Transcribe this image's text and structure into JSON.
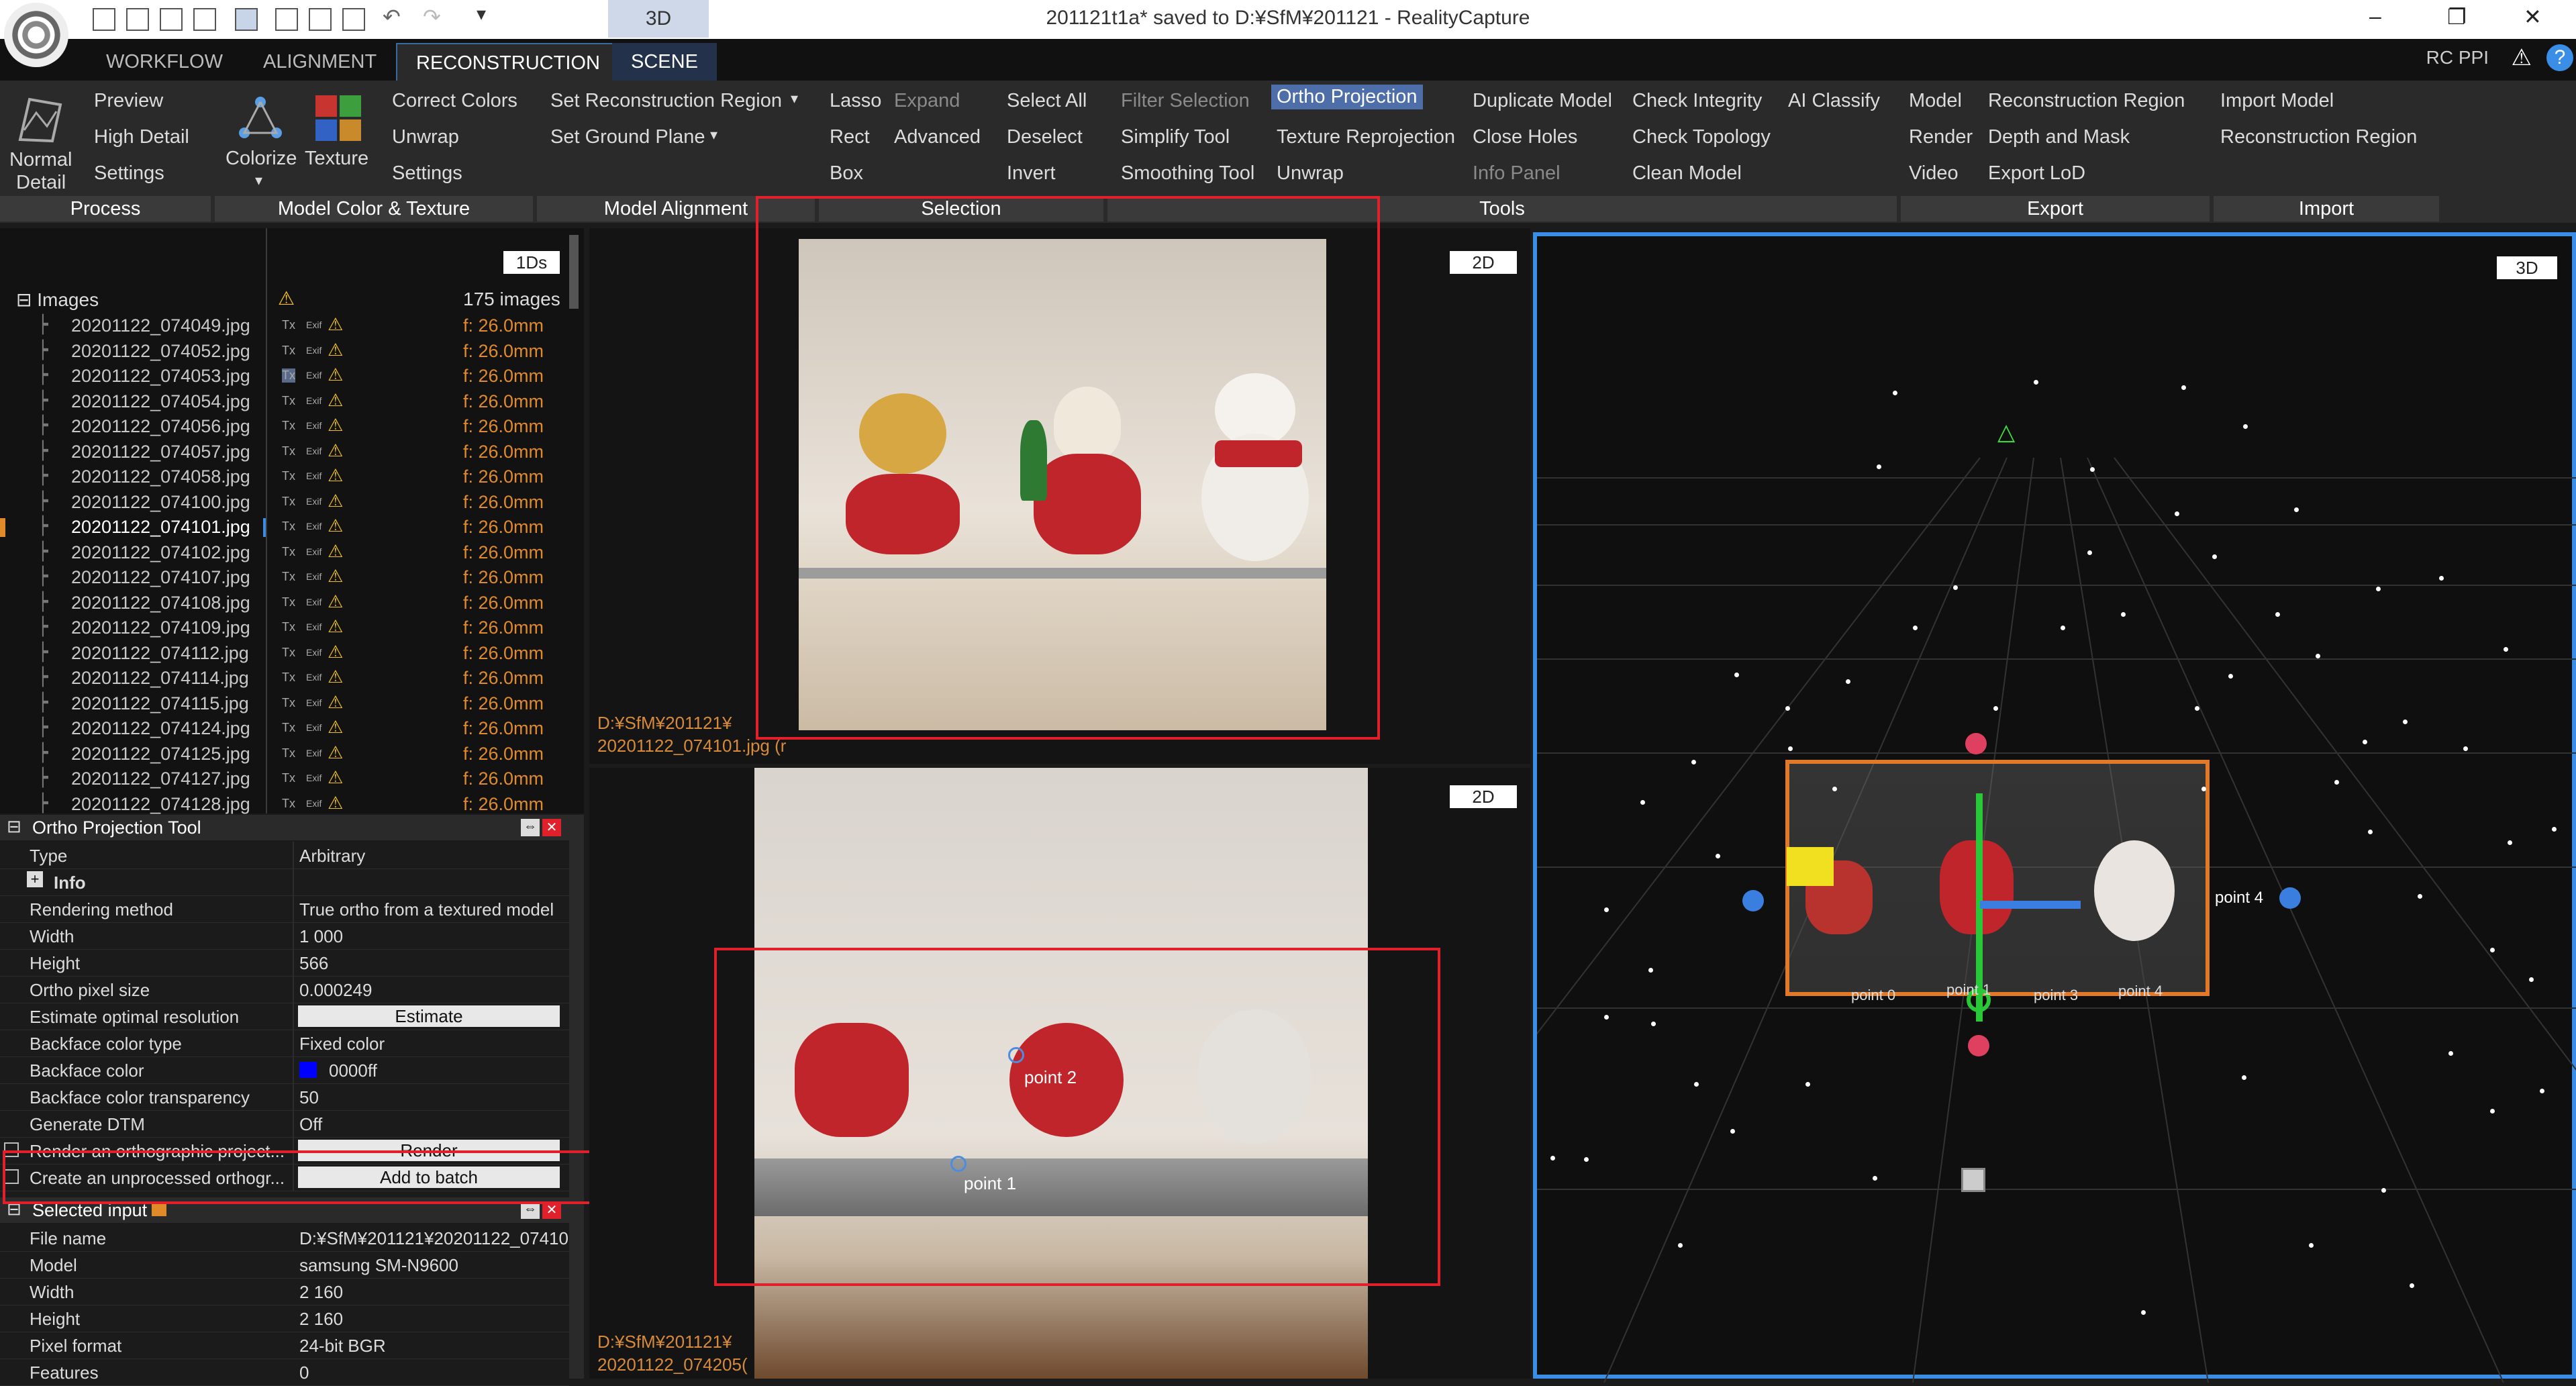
{
  "window": {
    "title": "201121t1a* saved to D:¥SfM¥201121 - RealityCapture",
    "view_tab": "3D",
    "min": "–",
    "restore": "❐",
    "close": "✕"
  },
  "menu_tabs": [
    "WORKFLOW",
    "ALIGNMENT",
    "RECONSTRUCTION",
    "SCENE"
  ],
  "rc_ppi": "RC PPI",
  "ribbon": {
    "process": {
      "normal": "Normal",
      "detail": "Detail",
      "preview": "Preview",
      "high_detail": "High Detail",
      "settings": "Settings"
    },
    "model_color": {
      "colorize": "Colorize",
      "texture": "Texture",
      "correct_colors": "Correct Colors",
      "unwrap": "Unwrap",
      "settings": "Settings"
    },
    "alignment": {
      "set_recon_region": "Set Reconstruction Region",
      "set_ground_plane": "Set Ground Plane"
    },
    "selection": {
      "lasso": "Lasso",
      "expand": "Expand",
      "select_all": "Select All",
      "rect": "Rect",
      "advanced": "Advanced",
      "deselect": "Deselect",
      "box": "Box",
      "invert": "Invert"
    },
    "tools": {
      "filter_selection": "Filter Selection",
      "ortho_projection": "Ortho Projection",
      "duplicate_model": "Duplicate Model",
      "check_integrity": "Check Integrity",
      "ai_classify": "AI Classify",
      "simplify_tool": "Simplify Tool",
      "texture_reprojection": "Texture Reprojection",
      "close_holes": "Close Holes",
      "check_topology": "Check Topology",
      "smoothing_tool": "Smoothing Tool",
      "unwrap": "Unwrap",
      "info_panel": "Info Panel",
      "clean_model": "Clean Model"
    },
    "export": {
      "model": "Model",
      "reconstruction_region": "Reconstruction Region",
      "render": "Render",
      "depth_and_mask": "Depth and Mask",
      "video": "Video",
      "export_lod": "Export LoD"
    },
    "import": {
      "import_model": "Import Model",
      "reconstruction_region": "Reconstruction Region"
    },
    "groups": [
      "Process",
      "Model Color & Texture",
      "Model Alignment",
      "Selection",
      "Tools",
      "Export",
      "Import"
    ]
  },
  "images_panel": {
    "badge": "1Ds",
    "root": "Images",
    "count": "175 images",
    "files": [
      "20201122_074049.jpg",
      "20201122_074052.jpg",
      "20201122_074053.jpg",
      "20201122_074054.jpg",
      "20201122_074056.jpg",
      "20201122_074057.jpg",
      "20201122_074058.jpg",
      "20201122_074100.jpg",
      "20201122_074101.jpg",
      "20201122_074102.jpg",
      "20201122_074107.jpg",
      "20201122_074108.jpg",
      "20201122_074109.jpg",
      "20201122_074112.jpg",
      "20201122_074114.jpg",
      "20201122_074115.jpg",
      "20201122_074124.jpg",
      "20201122_074125.jpg",
      "20201122_074127.jpg",
      "20201122_074128.jpg"
    ],
    "focal": "f: 26.0mm",
    "tx": "Tx",
    "exif": "Exif"
  },
  "ortho_tool": {
    "title": "Ortho Projection Tool",
    "rows": [
      {
        "label": "Type",
        "value": "Arbitrary"
      },
      {
        "label": "Info",
        "value": ""
      },
      {
        "label": "Rendering method",
        "value": "True ortho from a textured model"
      },
      {
        "label": "Width",
        "value": "1 000"
      },
      {
        "label": "Height",
        "value": "566"
      },
      {
        "label": "Ortho pixel size",
        "value": "0.000249"
      },
      {
        "label": "Estimate optimal resolution",
        "value": "Estimate"
      },
      {
        "label": "Backface color type",
        "value": "Fixed color"
      },
      {
        "label": "Backface color",
        "value": "0000ff"
      },
      {
        "label": "Backface color transparency",
        "value": "50"
      },
      {
        "label": "Generate DTM",
        "value": "Off"
      },
      {
        "label": "Render an orthographic project...",
        "value": "Render"
      },
      {
        "label": "Create an unprocessed orthogr...",
        "value": "Add to batch"
      }
    ]
  },
  "selected_input": {
    "title": "Selected input",
    "rows": [
      {
        "label": "File name",
        "value": "D:¥SfM¥201121¥20201122_07410..."
      },
      {
        "label": "Model",
        "value": "samsung SM-N9600"
      },
      {
        "label": "Width",
        "value": "2 160"
      },
      {
        "label": "Height",
        "value": "2 160"
      },
      {
        "label": "Pixel format",
        "value": "24-bit BGR"
      },
      {
        "label": "Features",
        "value": "0"
      }
    ]
  },
  "view_top": {
    "badge": "2D",
    "caption1": "D:¥SfM¥201121¥",
    "caption2": "20201122_074101.jpg (r"
  },
  "view_bottom": {
    "badge": "2D",
    "caption1": "D:¥SfM¥201121¥",
    "caption2": "20201122_074205(",
    "point1": "point 1",
    "point2": "point 2"
  },
  "view_3d": {
    "badge": "3D",
    "labels": [
      "point 4",
      "point 0",
      "point 1",
      "point 3",
      "point 4"
    ]
  },
  "colors": {
    "accent": "#3a8ee6",
    "highlight": "#e0202a",
    "backface": "#0000ff"
  }
}
